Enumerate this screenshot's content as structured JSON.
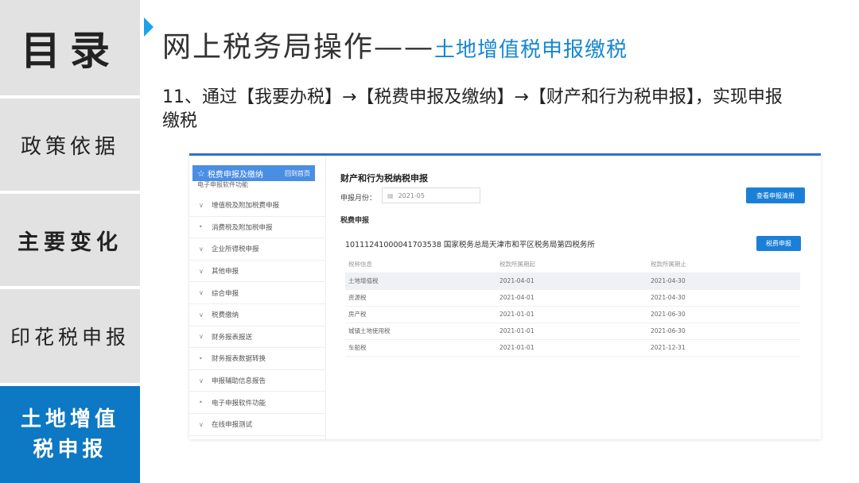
{
  "nav": {
    "title": "目录",
    "items": [
      "政策依据",
      "主要变化",
      "印花税申报"
    ],
    "active": "土地增值税申报"
  },
  "heading": {
    "main": "网上税务局操作——",
    "sub": "土地增值税申报缴税"
  },
  "step_text": "11、通过【我要办税】→【税费申报及缴纳】→【财产和行为税申报】，实现申报缴税",
  "screenshot": {
    "sidebar": {
      "header": "税费申报及缴纳",
      "home_link": "回到首页",
      "clipped_item": "电子申报软件功能",
      "items": [
        {
          "marker": "∨",
          "label": "增值税及附加税费申报"
        },
        {
          "marker": "•",
          "label": "消费税及附加税申报"
        },
        {
          "marker": "∨",
          "label": "企业所得税申报"
        },
        {
          "marker": "∨",
          "label": "其他申报"
        },
        {
          "marker": "∨",
          "label": "综合申报"
        },
        {
          "marker": "∨",
          "label": "税费缴纳"
        },
        {
          "marker": "∨",
          "label": "财务报表报送"
        },
        {
          "marker": "•",
          "label": "财务报表数据转换"
        },
        {
          "marker": "∨",
          "label": "申报辅助信息报告"
        },
        {
          "marker": "•",
          "label": "电子申报软件功能"
        },
        {
          "marker": "∨",
          "label": "在线申报测试"
        }
      ]
    },
    "main": {
      "title": "财产和行为税纳税申报",
      "month_label": "申报月份：",
      "month_value": "2021-05",
      "guide_button": "查看申报清册",
      "section_label": "税费申报",
      "taxpayer_line": "10111241000041703538 国家税务总局天津市和平区税务局第四税务所",
      "declare_button": "税费申报",
      "columns": [
        "税种信息",
        "税款所属期起",
        "税款所属期止"
      ],
      "rows": [
        [
          "土地增值税",
          "2021-04-01",
          "2021-04-30"
        ],
        [
          "资源税",
          "2021-04-01",
          "2021-04-30"
        ],
        [
          "房产税",
          "2021-01-01",
          "2021-06-30"
        ],
        [
          "城镇土地使用税",
          "2021-01-01",
          "2021-06-30"
        ],
        [
          "车船税",
          "2021-01-01",
          "2021-12-31"
        ]
      ]
    }
  },
  "colors": {
    "active_nav": "#0d78c3",
    "accent": "#1aa3e8",
    "button": "#1b7fd8"
  }
}
